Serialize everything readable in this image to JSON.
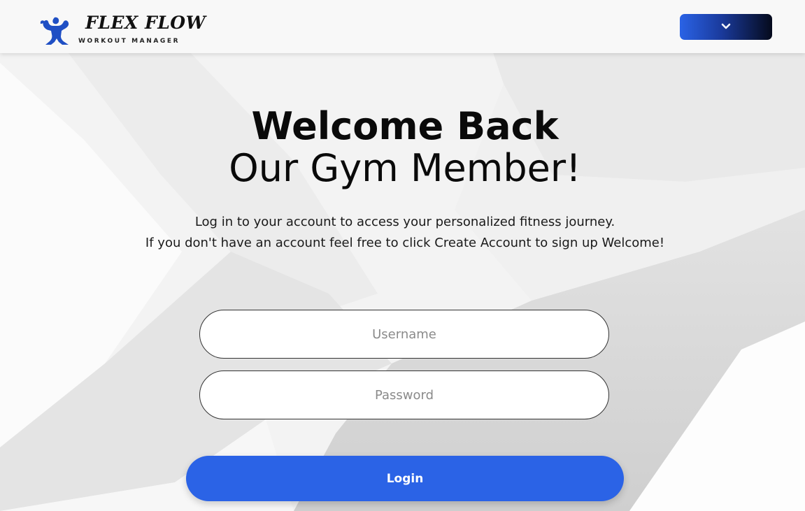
{
  "brand": {
    "name": "FLEX FLOW",
    "tagline": "WORKOUT MANAGER"
  },
  "nav": {
    "menu_icon": "chevron-down-icon"
  },
  "hero": {
    "title_line1": "Welcome Back",
    "title_line2": "Our Gym Member!",
    "subtitle_line1": "Log in to your account to access your personalized fitness journey.",
    "subtitle_line2": "If you don't have an account feel free to click Create Account to sign up Welcome!"
  },
  "form": {
    "username_placeholder": "Username",
    "username_value": "",
    "password_placeholder": "Password",
    "password_value": "",
    "login_label": "Login"
  },
  "colors": {
    "accent": "#2b63e6",
    "button_gradient_end": "#050a1c",
    "logo_blue": "#1f4fc4"
  }
}
